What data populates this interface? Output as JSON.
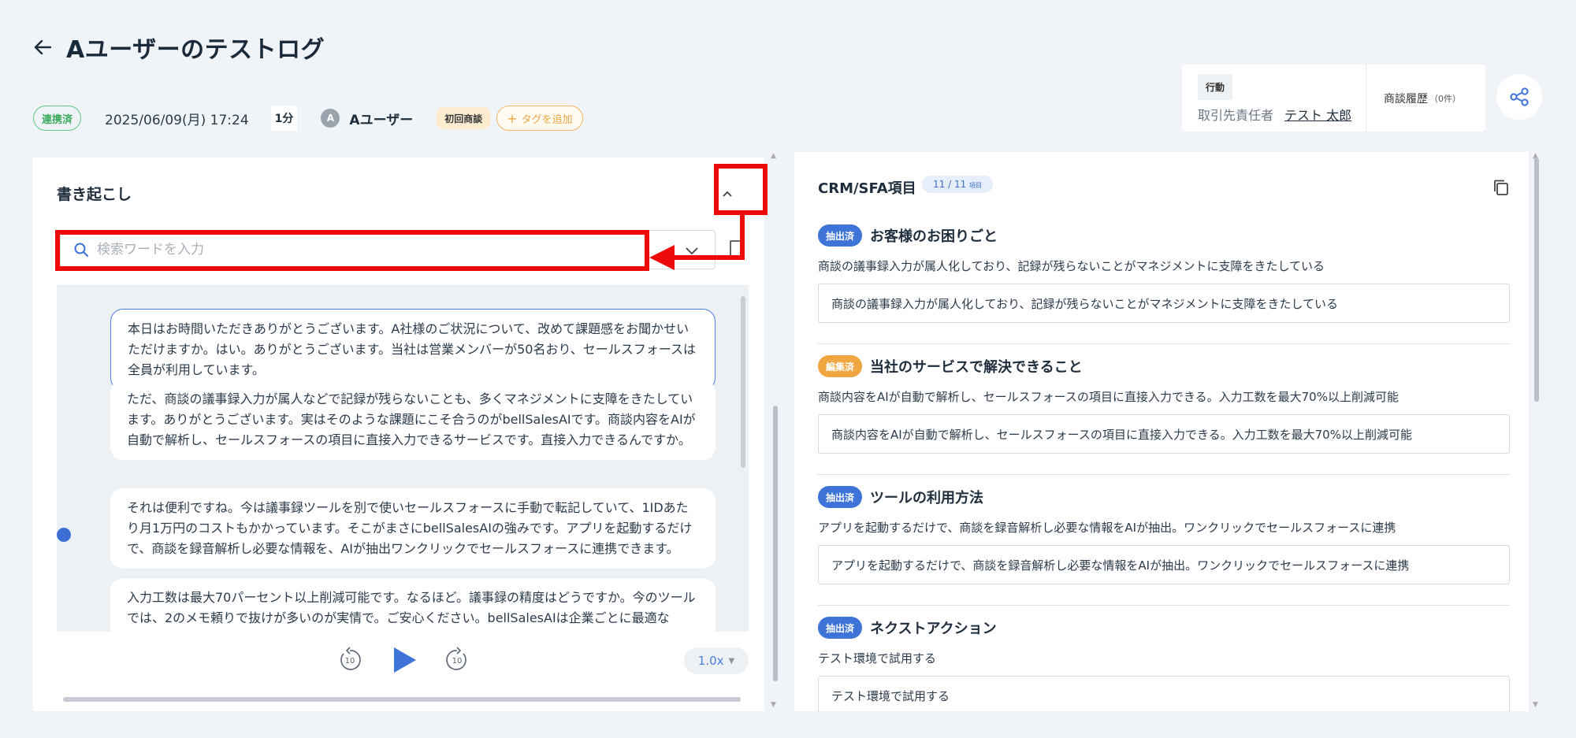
{
  "header": {
    "title": "Aユーザーのテストログ",
    "status_badge": "連携済",
    "date": "2025/06/09(月) 17:24",
    "duration": "1分",
    "avatar_initial": "A",
    "user_name": "Aユーザー",
    "tag": "初回商談",
    "add_tag_label": "タグを追加"
  },
  "info_card": {
    "action_label": "行動",
    "contact_key": "取引先責任者",
    "contact_value": "テスト 太郎",
    "history_label": "商談履歴",
    "history_count": "（0件）"
  },
  "transcript_panel": {
    "title": "書き起こし",
    "search_placeholder": "検索ワードを入力",
    "messages": [
      "本日はお時間いただきありがとうございます。A社様のご状況について、改めて課題感をお聞かせいただけますか。はい。ありがとうございます。当社は営業メンバーが50名おり、セールスフォースは全員が利用しています。",
      "ただ、商談の議事録入力が属人などで記録が残らないことも、多くマネジメントに支障をきたしています。ありがとうございます。実はそのような課題にこそ合うのがbellSalesAIです。商談内容をAIが自動で解析し、セールスフォースの項目に直接入力できるサービスです。直接入力できるんですか。",
      "それは便利ですね。今は議事録ツールを別で使いセールスフォースに手動で転記していて、1IDあたり月1万円のコストもかかっています。そこがまさにbellSalesAIの強みです。アプリを起動するだけで、商談を録音解析し必要な情報を、AIが抽出ワンクリックでセールスフォースに連携できます。",
      "入力工数は最大70パーセント以上削減可能です。なるほど。議事録の精度はどうですか。今のツールでは、2のメモ頼りで抜けが多いのが実情で。ご安心ください。bellSalesAIは企業ごとに最適な"
    ],
    "player": {
      "speed": "1.0x",
      "progress": 0.01
    }
  },
  "crm_panel": {
    "title": "CRM/SFA項目",
    "count": "11 / 11",
    "count_unit": "項目",
    "sections": [
      {
        "badge": "抽出済",
        "name": "お客様のお困りごと",
        "description": "商談の議事録入力が属人化しており、記録が残らないことがマネジメントに支障をきたしている",
        "value": "商談の議事録入力が属人化しており、記録が残らないことがマネジメントに支障をきたしている"
      },
      {
        "badge": "編集済",
        "name": "当社のサービスで解決できること",
        "description": "商談内容をAIが自動で解析し、セールスフォースの項目に直接入力できる。入力工数を最大70%以上削減可能",
        "value": "商談内容をAIが自動で解析し、セールスフォースの項目に直接入力できる。入力工数を最大70%以上削減可能"
      },
      {
        "badge": "抽出済",
        "name": "ツールの利用方法",
        "description": "アプリを起動するだけで、商談を録音解析し必要な情報をAIが抽出。ワンクリックでセールスフォースに連携",
        "value": "アプリを起動するだけで、商談を録音解析し必要な情報をAIが抽出。ワンクリックでセールスフォースに連携"
      },
      {
        "badge": "抽出済",
        "name": "ネクストアクション",
        "description": "テスト環境で試用する",
        "value": "テスト環境で試用する"
      }
    ]
  },
  "colors": {
    "accent_blue": "#3e74d8",
    "annotation_red": "#ec0a0a",
    "edited_orange": "#f0a640",
    "linked_green": "#3aa95c"
  }
}
